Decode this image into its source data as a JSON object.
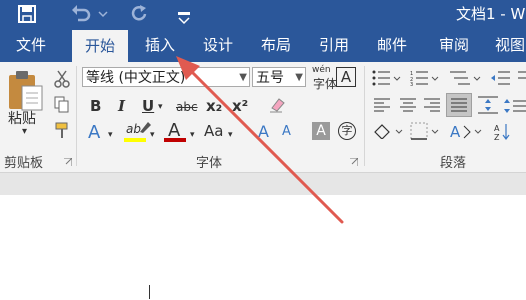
{
  "quick_access": {
    "save_icon": "save-icon",
    "undo_icon": "undo-icon",
    "redo_icon": "redo-icon",
    "customize_icon": "chevron-down-icon"
  },
  "window": {
    "title": "文档1 - W"
  },
  "tabs": [
    {
      "label": "文件"
    },
    {
      "label": "开始"
    },
    {
      "label": "插入"
    },
    {
      "label": "设计"
    },
    {
      "label": "布局"
    },
    {
      "label": "引用"
    },
    {
      "label": "邮件"
    },
    {
      "label": "审阅"
    },
    {
      "label": "视图"
    }
  ],
  "clipboard": {
    "paste_label": "粘贴",
    "group_label": "剪贴板"
  },
  "font": {
    "font_name": "等线 (中文正文)",
    "font_size": "五号",
    "group_label": "字体",
    "bold": "B",
    "italic": "I",
    "underline": "U",
    "strike": "abc",
    "subscript": "x₂",
    "superscript": "x²",
    "font_color_letter": "A",
    "case": "Aa",
    "text_effect": "A",
    "highlight": "ab",
    "shading": "A",
    "enclose": "字",
    "phonetic": "wén",
    "char_border": "A",
    "grow": "A",
    "shrink": "A"
  },
  "paragraph": {
    "group_label": "段落"
  },
  "colors": {
    "ribbon_blue": "#2b579a",
    "highlight_yellow": "#ffff00",
    "font_red": "#c00000",
    "annotation_arrow": "#e05a50"
  }
}
